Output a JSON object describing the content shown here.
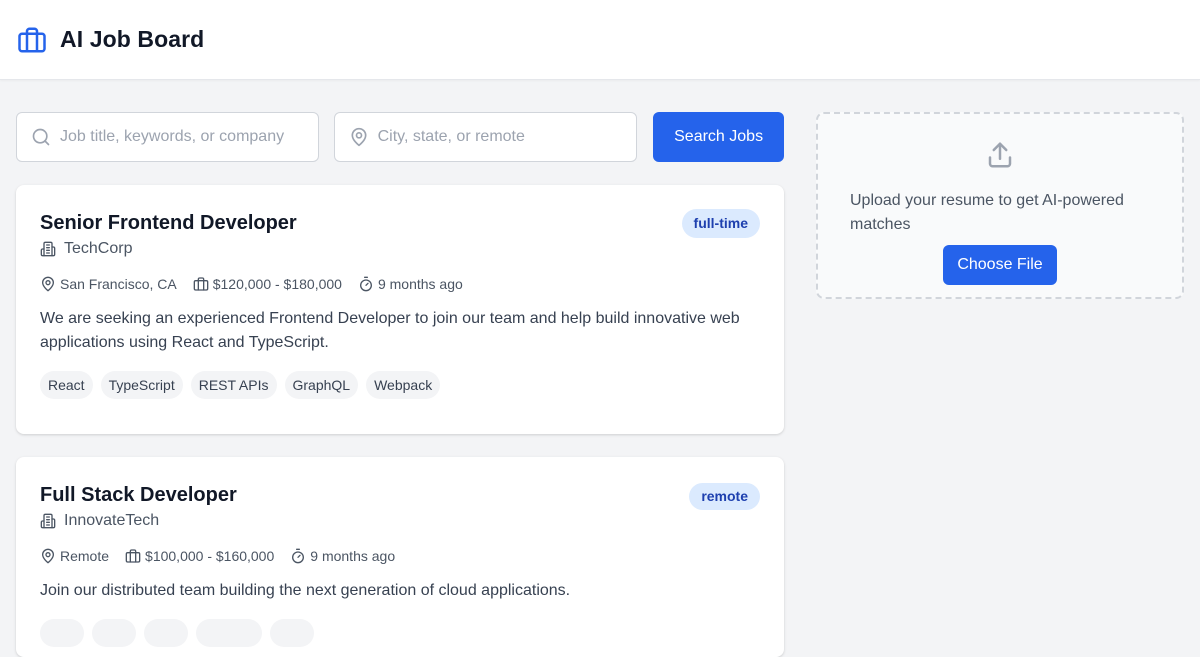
{
  "app": {
    "title": "AI Job Board",
    "logo_icon": "briefcase-icon",
    "accent_color": "#2563eb"
  },
  "search": {
    "keyword_placeholder": "Job title, keywords, or company",
    "keyword_value": "",
    "location_placeholder": "City, state, or remote",
    "location_value": "",
    "button_label": "Search Jobs"
  },
  "upload": {
    "icon": "upload-icon",
    "message": "Upload your resume to get AI-powered matches",
    "button_label": "Choose File"
  },
  "jobs": [
    {
      "title": "Senior Frontend Developer",
      "company": "TechCorp",
      "type": "full-time",
      "location": "San Francisco, CA",
      "salary": "$120,000 - $180,000",
      "posted": "9 months ago",
      "description": "We are seeking an experienced Frontend Developer to join our team and help build innovative web applications using React and TypeScript.",
      "tags": [
        "React",
        "TypeScript",
        "REST APIs",
        "GraphQL",
        "Webpack"
      ]
    },
    {
      "title": "Full Stack Developer",
      "company": "InnovateTech",
      "type": "remote",
      "location": "Remote",
      "salary": "$100,000 - $160,000",
      "posted": "9 months ago",
      "description": "Join our distributed team building the next generation of cloud applications."
    }
  ]
}
